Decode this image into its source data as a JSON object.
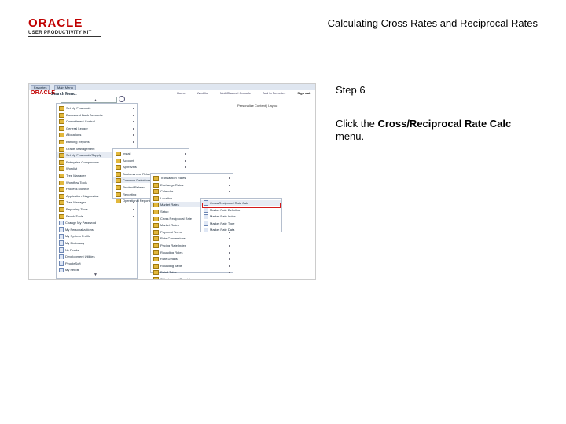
{
  "logo": {
    "brand": "ORACLE",
    "product": "USER PRODUCTIVITY KIT"
  },
  "slide_title": "Calculating Cross Rates and Reciprocal Rates",
  "step": "Step 6",
  "instruction": {
    "prefix": "Click the ",
    "target": "Cross/Reciprocal Rate Calc",
    "suffix": " menu."
  },
  "screenshot": {
    "tabs": [
      "Favorites",
      "Main Menu"
    ],
    "mini_logo": "ORACLE",
    "header_links": [
      "Home",
      "Worklist",
      "MultiChannel Console",
      "Add to Favorites",
      "Sign out"
    ],
    "search_title": "Search Menu:",
    "personalize": "Personalize Content | Layout",
    "col1_items": [
      "Set Up Financials",
      "Banks and Bank Accounts",
      "Commitment Control",
      "General Ledger",
      "Allocations",
      "Banking Reports",
      "Grants Management",
      "Set Up Financials/Supply",
      "Enterprise Components",
      "Worklist",
      "Tree Manager",
      "Workflow Tools",
      "Process Monitor",
      "Application Diagnostics",
      "Tree Manager",
      "Reporting Tools",
      "PeopleTools",
      "Change My Password",
      "My Personalizations",
      "My System Profile",
      "My Dictionary",
      "Ny Feeds",
      "Development Utilities",
      "PeopleSoft",
      "My Feeds"
    ],
    "col2_items": [
      "Install",
      "Account",
      "Approvals",
      "Business and Related",
      "Common Definitions",
      "Product Related",
      "Reporting",
      "Operational Reporting"
    ],
    "col3_items": [
      "Transaction Rates",
      "Exchange Rates",
      "Calendar",
      "Location",
      "Market Rates",
      "Setup",
      "Cross Reciprocal Rate",
      "Market Rates",
      "Payment Terms",
      "Rate Conversions",
      "Pricing Rate Index",
      "Rounding Rules",
      "Rate Details",
      "Rounding Table",
      "Detail Table",
      "Shipping and Receiving"
    ],
    "col4_items": [
      "Cross/Reciprocal Rate Calc",
      "Market Rate Definition",
      "Market Rate Index",
      "Market Rate Type",
      "Market Rate Data"
    ]
  }
}
